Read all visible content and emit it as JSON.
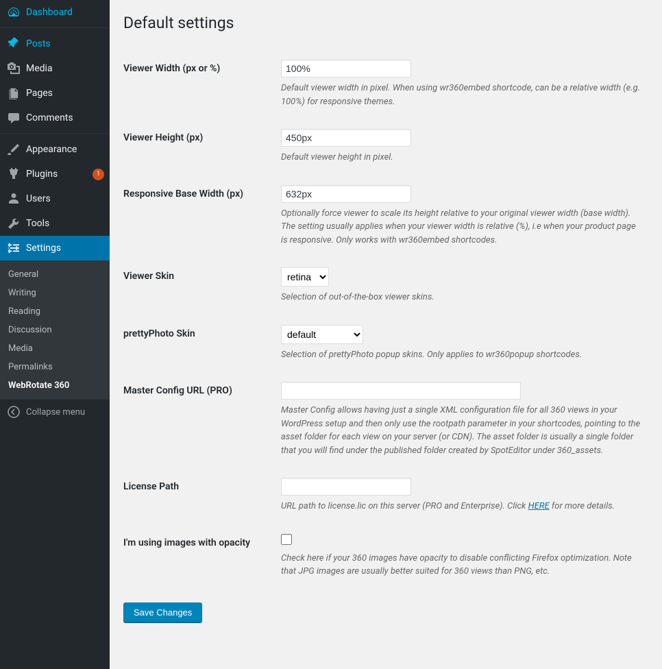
{
  "sidebar": {
    "items": [
      {
        "label": "Dashboard",
        "icon": "dashboard"
      },
      {
        "label": "Posts",
        "icon": "posts",
        "current": true
      },
      {
        "label": "Media",
        "icon": "media"
      },
      {
        "label": "Pages",
        "icon": "pages"
      },
      {
        "label": "Comments",
        "icon": "comments"
      },
      {
        "label": "Appearance",
        "icon": "appearance"
      },
      {
        "label": "Plugins",
        "icon": "plugins",
        "badge": "1"
      },
      {
        "label": "Users",
        "icon": "users"
      },
      {
        "label": "Tools",
        "icon": "tools"
      },
      {
        "label": "Settings",
        "icon": "settings",
        "open": true
      }
    ],
    "submenu": [
      "General",
      "Writing",
      "Reading",
      "Discussion",
      "Media",
      "Permalinks",
      "WebRotate 360"
    ],
    "collapse": "Collapse menu"
  },
  "page": {
    "title": "Default settings"
  },
  "fields": {
    "viewer_width": {
      "label": "Viewer Width (px or %)",
      "value": "100%",
      "desc": "Default viewer width in pixel. When using wr360embed shortcode, can be a relative width (e.g. 100%) for responsive themes."
    },
    "viewer_height": {
      "label": "Viewer Height (px)",
      "value": "450px",
      "desc": "Default viewer height in pixel."
    },
    "base_width": {
      "label": "Responsive Base Width (px)",
      "value": "632px",
      "desc1": "Optionally force viewer to scale its height relative to your original viewer width (base width).",
      "desc2": "The setting usually applies when your viewer width is relative (%), i.e when your product page is responsive. Only works with wr360embed shortcodes."
    },
    "viewer_skin": {
      "label": "Viewer Skin",
      "value": "retina",
      "desc": "Selection of out-of-the-box viewer skins."
    },
    "pretty_skin": {
      "label": "prettyPhoto Skin",
      "value": "default",
      "desc": "Selection of prettyPhoto popup skins. Only applies to wr360popup shortcodes."
    },
    "master_config": {
      "label": "Master Config URL (PRO)",
      "value": "",
      "desc": "Master Config allows having just a single XML configuration file for all 360 views in your WordPress setup and then only use the rootpath parameter in your shortcodes, pointing to the asset folder for each view on your server (or CDN). The asset folder is usually a single folder that you will find under the published folder created by SpotEditor under 360_assets."
    },
    "license_path": {
      "label": "License Path",
      "value": "",
      "desc_prefix": "URL path to license.lic on this server (PRO and Enterprise). Click ",
      "desc_link": "HERE",
      "desc_suffix": " for more details."
    },
    "opacity": {
      "label": "I'm using images with opacity",
      "desc": "Check here if your 360 images have opacity to disable conflicting Firefox optimization. Note that JPG images are usually better suited for 360 views than PNG, etc."
    }
  },
  "submit": "Save Changes"
}
